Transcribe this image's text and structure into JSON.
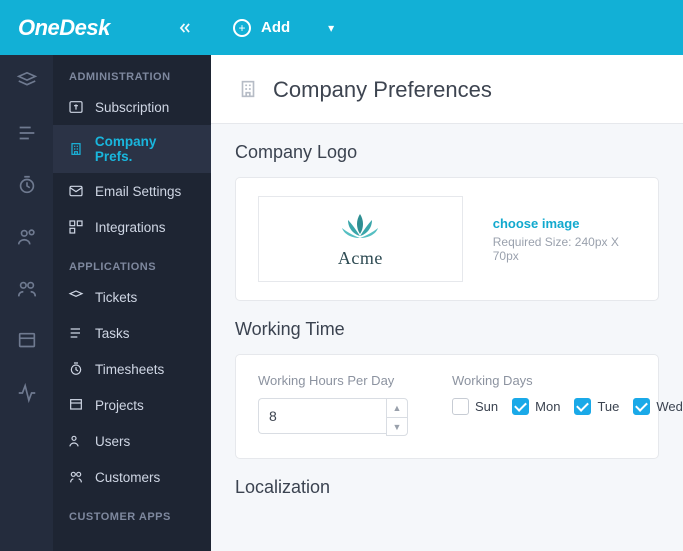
{
  "brand": "OneDesk",
  "topbar": {
    "add_label": "Add"
  },
  "sidebar": {
    "section_admin": "ADMINISTRATION",
    "section_apps": "APPLICATIONS",
    "section_custapps": "CUSTOMER APPS",
    "admin": [
      {
        "label": "Subscription"
      },
      {
        "label": "Company Prefs."
      },
      {
        "label": "Email Settings"
      },
      {
        "label": "Integrations"
      }
    ],
    "apps": [
      {
        "label": "Tickets"
      },
      {
        "label": "Tasks"
      },
      {
        "label": "Timesheets"
      },
      {
        "label": "Projects"
      },
      {
        "label": "Users"
      },
      {
        "label": "Customers"
      }
    ]
  },
  "page": {
    "title": "Company Preferences"
  },
  "logo_section": {
    "heading": "Company Logo",
    "company_name": "Acme",
    "choose_label": "choose image",
    "required_size": "Required Size: 240px X 70px"
  },
  "working_time": {
    "heading": "Working Time",
    "hours_label": "Working Hours Per Day",
    "hours_value": "8",
    "days_label": "Working Days",
    "days": [
      {
        "label": "Sun",
        "checked": false
      },
      {
        "label": "Mon",
        "checked": true
      },
      {
        "label": "Tue",
        "checked": true
      },
      {
        "label": "Wed",
        "checked": true
      }
    ]
  },
  "localization": {
    "heading": "Localization"
  }
}
